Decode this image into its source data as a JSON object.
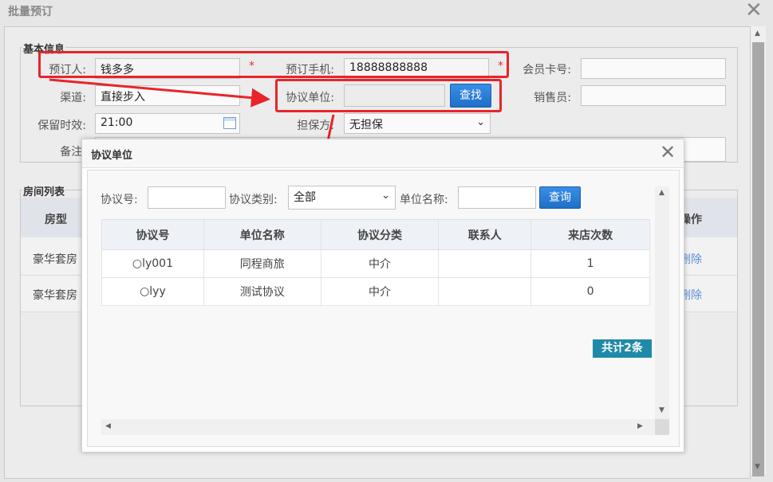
{
  "window": {
    "title": "批量预订"
  },
  "basic_info": {
    "legend": "基本信息",
    "booker_label": "预订人:",
    "booker_value": "钱多多",
    "phone_label": "预订手机:",
    "phone_value": "18888888888",
    "card_label": "会员卡号:",
    "card_value": "",
    "channel_label": "渠道:",
    "channel_value": "直接步入",
    "agreement_label": "协议单位:",
    "agreement_value": "",
    "search_button": "查找",
    "sales_label": "销售员:",
    "sales_value": "",
    "hold_label": "保留时效:",
    "hold_value": "21:00",
    "guarantee_label": "担保方:",
    "guarantee_value": "无担保",
    "remark_label": "备注:",
    "required_mark": "*"
  },
  "room_list": {
    "legend": "房间列表",
    "col_room_type": "房型",
    "col_action": "操作",
    "rows": [
      {
        "room_type": "豪华套房",
        "action": "删除"
      },
      {
        "room_type": "豪华套房",
        "action": "删除"
      }
    ]
  },
  "modal": {
    "title": "协议单位",
    "filter_no_label": "协议号:",
    "filter_no_value": "",
    "filter_type_label": "协议类别:",
    "filter_type_value": "全部",
    "filter_name_label": "单位名称:",
    "filter_name_value": "",
    "query_button": "查询",
    "columns": [
      "协议号",
      "单位名称",
      "协议分类",
      "联系人",
      "来店次数"
    ],
    "rows": [
      {
        "no": "ly001",
        "name": "同程商旅",
        "category": "中介",
        "contact": "",
        "visits": "1"
      },
      {
        "no": "lyy",
        "name": "测试协议",
        "category": "中介",
        "contact": "",
        "visits": "0"
      }
    ],
    "total": "共计2条"
  },
  "colors": {
    "highlight": "#e8242a",
    "button": "#1e6fc8",
    "badge": "#1f8aa8"
  },
  "icons": {
    "close": "close-icon",
    "calendar": "calendar-icon",
    "dropdown": "chevron-down-icon",
    "radio": "radio-icon"
  }
}
